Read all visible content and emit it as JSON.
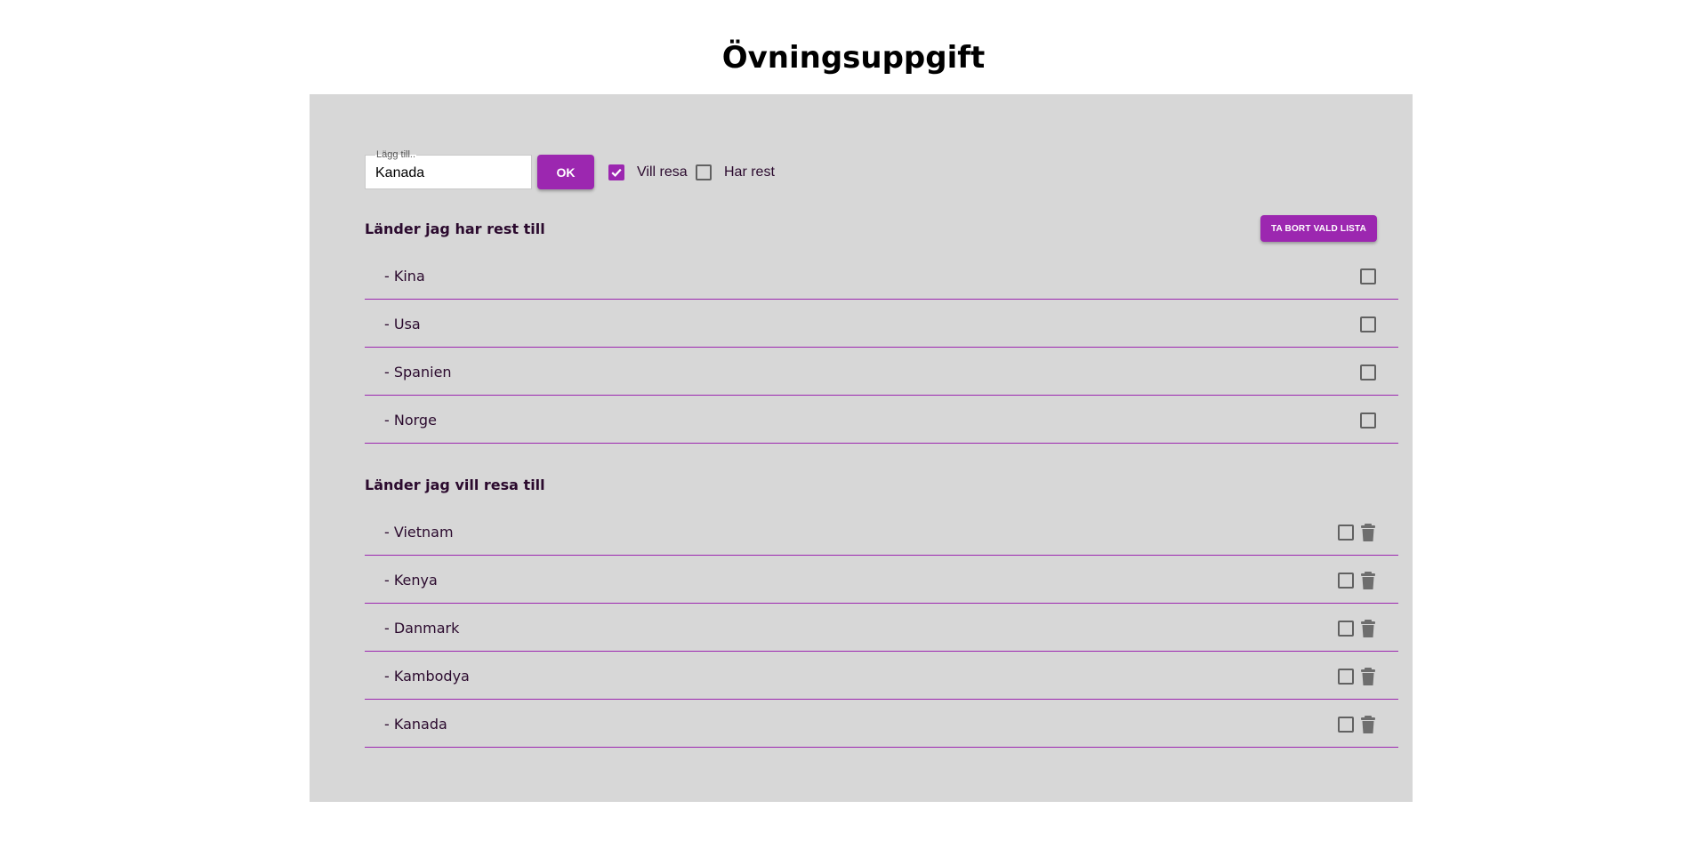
{
  "page": {
    "title": "Övningsuppgift"
  },
  "colors": {
    "accent": "#9c27b0",
    "panel_bg": "#d7d7d7",
    "text": "#2b0a2e"
  },
  "add_form": {
    "legend": "Lägg till..",
    "value": "Kanada",
    "ok_label": "OK",
    "options": [
      {
        "label": "Vill resa",
        "checked": true
      },
      {
        "label": "Har rest",
        "checked": false
      }
    ]
  },
  "visited": {
    "title": "Länder jag har rest till",
    "remove_label": "TA BORT VALD LISTA",
    "items": [
      {
        "label": "- Kina",
        "checked": false
      },
      {
        "label": "- Usa",
        "checked": false
      },
      {
        "label": "- Spanien",
        "checked": false
      },
      {
        "label": "- Norge",
        "checked": false
      }
    ]
  },
  "wishlist": {
    "title": "Länder jag vill resa till",
    "items": [
      {
        "label": "- Vietnam",
        "checked": false,
        "icon": "trash-icon"
      },
      {
        "label": "- Kenya",
        "checked": false,
        "icon": "trash-icon"
      },
      {
        "label": "- Danmark",
        "checked": false,
        "icon": "trash-icon"
      },
      {
        "label": "- Kambodya",
        "checked": false,
        "icon": "trash-icon"
      },
      {
        "label": "- Kanada",
        "checked": false,
        "icon": "trash-icon"
      }
    ]
  }
}
